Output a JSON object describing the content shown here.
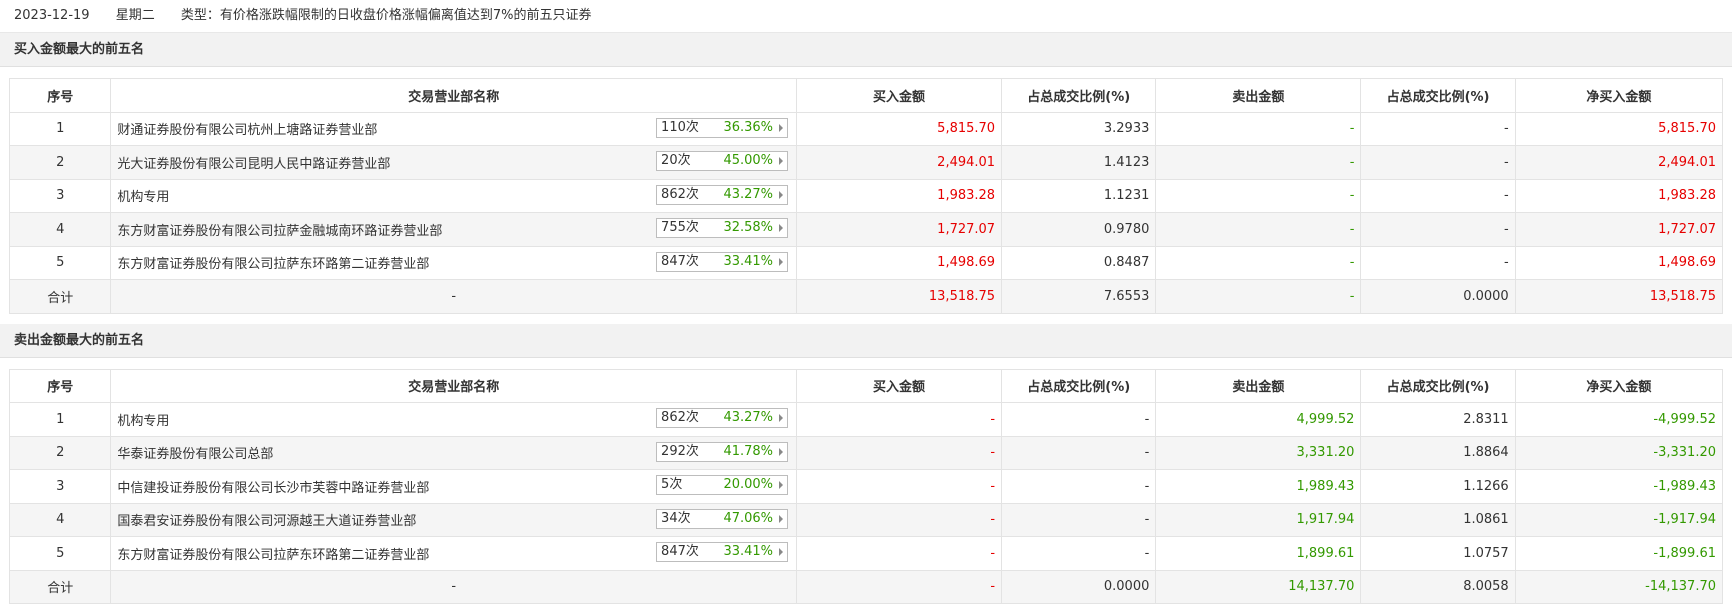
{
  "header": {
    "date": "2023-12-19",
    "weekday": "星期二",
    "type_text": "类型：有价格涨跌幅限制的日收盘价格涨幅偏离值达到7%的前五只证券"
  },
  "columns": [
    "序号",
    "交易营业部名称",
    "买入金额",
    "占总成交比例(%)",
    "卖出金额",
    "占总成交比例(%)",
    "净买入金额"
  ],
  "buy": {
    "title": "买入金额最大的前五名",
    "rows": [
      {
        "no": "1",
        "name": "财通证券股份有限公司杭州上塘路证券营业部",
        "count": "110次",
        "rate": "36.36%",
        "buy": "5,815.70",
        "buy_pct": "3.2933",
        "sell": "-",
        "sell_pct": "-",
        "net": "5,815.70"
      },
      {
        "no": "2",
        "name": "光大证券股份有限公司昆明人民中路证券营业部",
        "count": "20次",
        "rate": "45.00%",
        "buy": "2,494.01",
        "buy_pct": "1.4123",
        "sell": "-",
        "sell_pct": "-",
        "net": "2,494.01"
      },
      {
        "no": "3",
        "name": "机构专用",
        "count": "862次",
        "rate": "43.27%",
        "buy": "1,983.28",
        "buy_pct": "1.1231",
        "sell": "-",
        "sell_pct": "-",
        "net": "1,983.28"
      },
      {
        "no": "4",
        "name": "东方财富证券股份有限公司拉萨金融城南环路证券营业部",
        "count": "755次",
        "rate": "32.58%",
        "buy": "1,727.07",
        "buy_pct": "0.9780",
        "sell": "-",
        "sell_pct": "-",
        "net": "1,727.07"
      },
      {
        "no": "5",
        "name": "东方财富证券股份有限公司拉萨东环路第二证券营业部",
        "count": "847次",
        "rate": "33.41%",
        "buy": "1,498.69",
        "buy_pct": "0.8487",
        "sell": "-",
        "sell_pct": "-",
        "net": "1,498.69"
      }
    ],
    "total": {
      "label": "合计",
      "name": "-",
      "buy": "13,518.75",
      "buy_pct": "7.6553",
      "sell": "-",
      "sell_pct": "0.0000",
      "net": "13,518.75"
    }
  },
  "sell": {
    "title": "卖出金额最大的前五名",
    "rows": [
      {
        "no": "1",
        "name": "机构专用",
        "count": "862次",
        "rate": "43.27%",
        "buy": "-",
        "buy_pct": "-",
        "sell": "4,999.52",
        "sell_pct": "2.8311",
        "net": "-4,999.52"
      },
      {
        "no": "2",
        "name": "华泰证券股份有限公司总部",
        "count": "292次",
        "rate": "41.78%",
        "buy": "-",
        "buy_pct": "-",
        "sell": "3,331.20",
        "sell_pct": "1.8864",
        "net": "-3,331.20"
      },
      {
        "no": "3",
        "name": "中信建投证券股份有限公司长沙市芙蓉中路证券营业部",
        "count": "5次",
        "rate": "20.00%",
        "buy": "-",
        "buy_pct": "-",
        "sell": "1,989.43",
        "sell_pct": "1.1266",
        "net": "-1,989.43"
      },
      {
        "no": "4",
        "name": "国泰君安证券股份有限公司河源越王大道证券营业部",
        "count": "34次",
        "rate": "47.06%",
        "buy": "-",
        "buy_pct": "-",
        "sell": "1,917.94",
        "sell_pct": "1.0861",
        "net": "-1,917.94"
      },
      {
        "no": "5",
        "name": "东方财富证券股份有限公司拉萨东环路第二证券营业部",
        "count": "847次",
        "rate": "33.41%",
        "buy": "-",
        "buy_pct": "-",
        "sell": "1,899.61",
        "sell_pct": "1.0757",
        "net": "-1,899.61"
      }
    ],
    "total": {
      "label": "合计",
      "name": "-",
      "buy": "-",
      "buy_pct": "0.0000",
      "sell": "14,137.70",
      "sell_pct": "8.0058",
      "net": "-14,137.70"
    }
  }
}
